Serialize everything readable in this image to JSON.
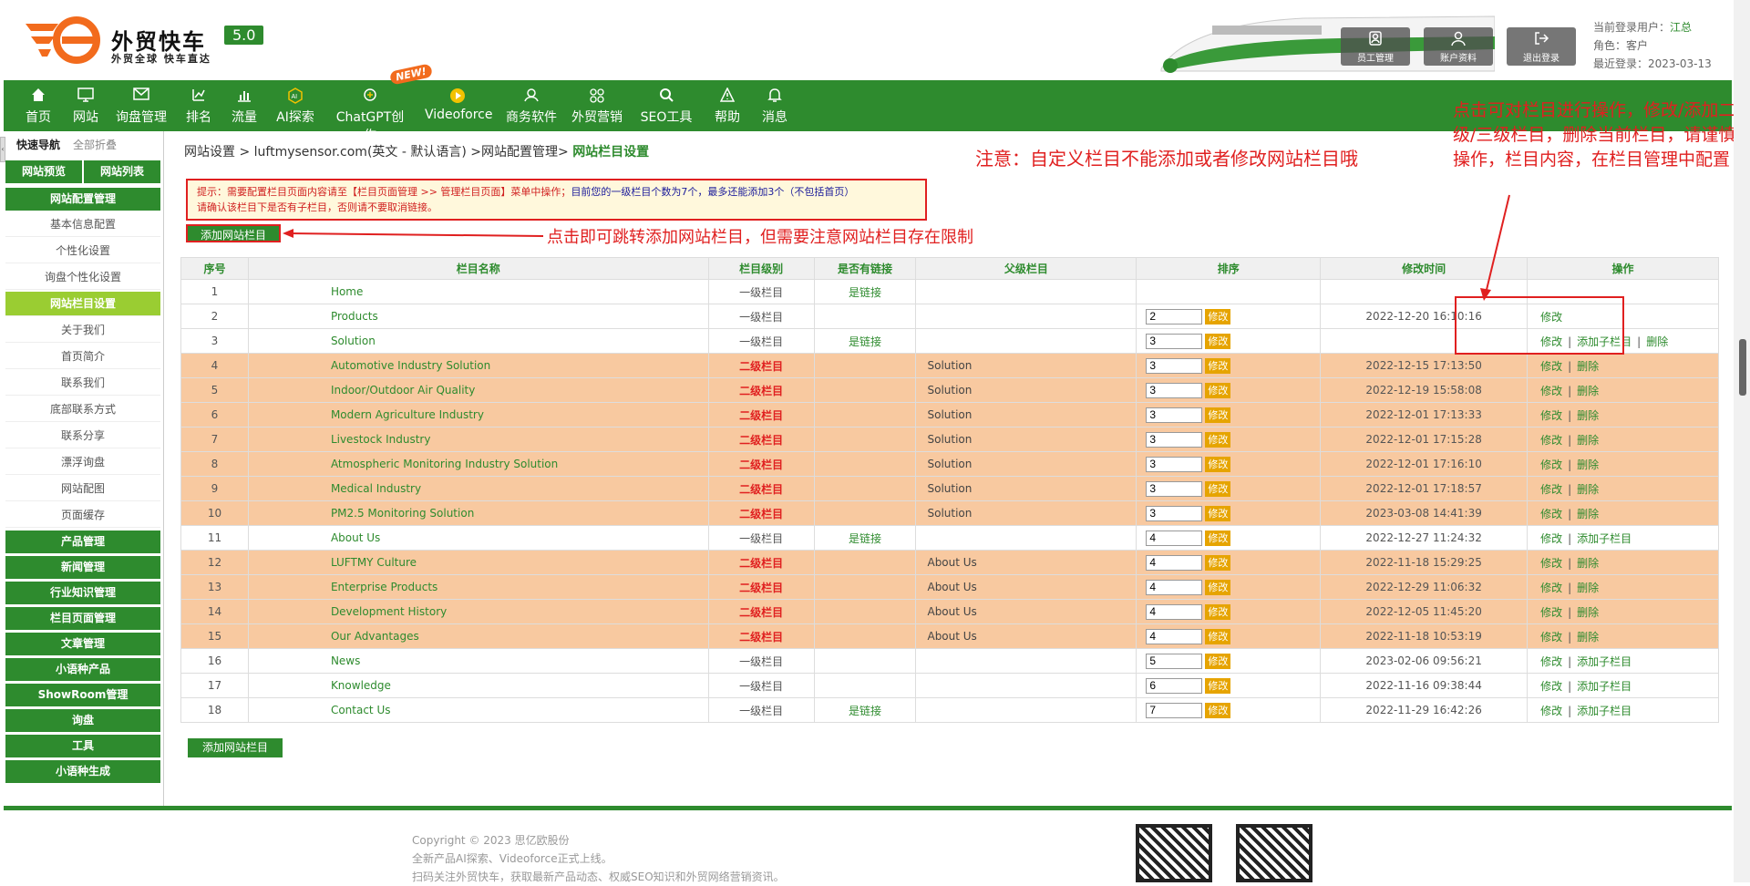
{
  "brand": {
    "name": "外贸快车",
    "version": "5.0",
    "slogan": "外贸全球 快车直达"
  },
  "header_buttons": [
    {
      "label": "员工管理",
      "icon": "staff-icon"
    },
    {
      "label": "账户资料",
      "icon": "user-icon"
    },
    {
      "label": "退出登录",
      "icon": "logout-icon"
    }
  ],
  "user": {
    "login_label": "当前登录用户：",
    "login_name": "江总",
    "role_label": "角色：",
    "role": "客户",
    "last_label": "最近登录：",
    "last": "2023-03-13"
  },
  "nav": [
    {
      "label": "首页",
      "icon": "home-icon"
    },
    {
      "label": "网站",
      "icon": "monitor-icon"
    },
    {
      "label": "询盘管理",
      "icon": "mail-icon"
    },
    {
      "label": "排名",
      "icon": "rank-icon"
    },
    {
      "label": "流量",
      "icon": "chart-icon"
    },
    {
      "label": "AI探索",
      "icon": "ai-icon"
    },
    {
      "label": "ChatGPT创作",
      "icon": "chatgpt-icon"
    },
    {
      "label": "Videoforce",
      "icon": "video-icon"
    },
    {
      "label": "商务软件",
      "icon": "software-icon"
    },
    {
      "label": "外贸营销",
      "icon": "marketing-icon"
    },
    {
      "label": "SEO工具",
      "icon": "search-icon"
    },
    {
      "label": "帮助",
      "icon": "help-icon"
    },
    {
      "label": "消息",
      "icon": "bell-icon"
    }
  ],
  "new_badge": "NEW!",
  "sidebar": {
    "quick_nav": "快速导航",
    "collapse_all": "全部折叠",
    "preview": "网站预览",
    "site_list": "网站列表",
    "config_group": "网站配置管理",
    "config_items": [
      "基本信息配置",
      "个性化设置",
      "询盘个性化设置",
      "网站栏目设置",
      "关于我们",
      "首页简介",
      "联系我们",
      "底部联系方式",
      "联系分享",
      "漂浮询盘",
      "网站配图",
      "页面缓存"
    ],
    "groups": [
      "产品管理",
      "新闻管理",
      "行业知识管理",
      "栏目页面管理",
      "文章管理",
      "小语种产品",
      "ShowRoom管理",
      "询盘",
      "工具",
      "小语种生成"
    ]
  },
  "breadcrumb": {
    "path": "网站设置 > luftmysensor.com(英文 - 默认语言) >网站配置管理> ",
    "current": "网站栏目设置"
  },
  "notice": {
    "part1": "提示：需要配置栏目页面内容请至【栏目页面管理 >> 管理栏目页面】菜单中操作；",
    "part2": "目前您的一级栏目个数为7个，最多还能添加3个（不包括首页）",
    "part3": "请确认该栏目下是否有子栏目，否则请不要取消链接。"
  },
  "add_button": "添加网站栏目",
  "annotations": {
    "a1": "注意：自定义栏目不能添加或者修改网站栏目哦",
    "a2": "点击即可跳转添加网站栏目，但需要注意网站栏目存在限制",
    "a3": "点击可对栏目进行操作，修改/添加二级/三级栏目，删除当前栏目，请谨慎操作，栏目内容，在栏目管理中配置"
  },
  "table": {
    "headers": [
      "序号",
      "栏目名称",
      "栏目级别",
      "是否有链接",
      "父级栏目",
      "排序",
      "修改时间",
      "操作"
    ],
    "sort_btn": "修改",
    "op_edit": "修改",
    "op_add": "添加子栏目",
    "op_delete": "删除",
    "rows": [
      {
        "no": "1",
        "name": "Home",
        "level": "一级栏目",
        "link": "是链接",
        "parent": "",
        "sort": "",
        "time": "",
        "ops": []
      },
      {
        "no": "2",
        "name": "Products",
        "level": "一级栏目",
        "link": "",
        "parent": "",
        "sort": "2",
        "time": "2022-12-20 16:10:16",
        "ops": [
          "edit"
        ]
      },
      {
        "no": "3",
        "name": "Solution",
        "level": "一级栏目",
        "link": "是链接",
        "parent": "",
        "sort": "3",
        "time": "",
        "ops": [
          "edit",
          "add",
          "delete"
        ]
      },
      {
        "no": "4",
        "name": "Automotive Industry Solution",
        "level": "二级栏目",
        "link": "",
        "parent": "Solution",
        "sort": "3",
        "time": "2022-12-15 17:13:50",
        "ops": [
          "edit",
          "delete"
        ]
      },
      {
        "no": "5",
        "name": "Indoor/Outdoor Air Quality",
        "level": "二级栏目",
        "link": "",
        "parent": "Solution",
        "sort": "3",
        "time": "2022-12-19 15:58:08",
        "ops": [
          "edit",
          "delete"
        ]
      },
      {
        "no": "6",
        "name": "Modern Agriculture Industry",
        "level": "二级栏目",
        "link": "",
        "parent": "Solution",
        "sort": "3",
        "time": "2022-12-01 17:13:33",
        "ops": [
          "edit",
          "delete"
        ]
      },
      {
        "no": "7",
        "name": "Livestock Industry",
        "level": "二级栏目",
        "link": "",
        "parent": "Solution",
        "sort": "3",
        "time": "2022-12-01 17:15:28",
        "ops": [
          "edit",
          "delete"
        ]
      },
      {
        "no": "8",
        "name": "Atmospheric Monitoring Industry Solution",
        "level": "二级栏目",
        "link": "",
        "parent": "Solution",
        "sort": "3",
        "time": "2022-12-01 17:16:10",
        "ops": [
          "edit",
          "delete"
        ]
      },
      {
        "no": "9",
        "name": "Medical Industry",
        "level": "二级栏目",
        "link": "",
        "parent": "Solution",
        "sort": "3",
        "time": "2022-12-01 17:18:57",
        "ops": [
          "edit",
          "delete"
        ]
      },
      {
        "no": "10",
        "name": "PM2.5 Monitoring Solution",
        "level": "二级栏目",
        "link": "",
        "parent": "Solution",
        "sort": "3",
        "time": "2023-03-08 14:41:39",
        "ops": [
          "edit",
          "delete"
        ]
      },
      {
        "no": "11",
        "name": "About Us",
        "level": "一级栏目",
        "link": "是链接",
        "parent": "",
        "sort": "4",
        "time": "2022-12-27 11:24:32",
        "ops": [
          "edit",
          "add"
        ]
      },
      {
        "no": "12",
        "name": "LUFTMY Culture",
        "level": "二级栏目",
        "link": "",
        "parent": "About Us",
        "sort": "4",
        "time": "2022-11-18 15:29:25",
        "ops": [
          "edit",
          "delete"
        ]
      },
      {
        "no": "13",
        "name": "Enterprise Products",
        "level": "二级栏目",
        "link": "",
        "parent": "About Us",
        "sort": "4",
        "time": "2022-12-29 11:06:32",
        "ops": [
          "edit",
          "delete"
        ]
      },
      {
        "no": "14",
        "name": "Development History",
        "level": "二级栏目",
        "link": "",
        "parent": "About Us",
        "sort": "4",
        "time": "2022-12-05 11:45:20",
        "ops": [
          "edit",
          "delete"
        ]
      },
      {
        "no": "15",
        "name": "Our Advantages",
        "level": "二级栏目",
        "link": "",
        "parent": "About Us",
        "sort": "4",
        "time": "2022-11-18 10:53:19",
        "ops": [
          "edit",
          "delete"
        ]
      },
      {
        "no": "16",
        "name": "News",
        "level": "一级栏目",
        "link": "",
        "parent": "",
        "sort": "5",
        "time": "2023-02-06 09:56:21",
        "ops": [
          "edit",
          "add"
        ]
      },
      {
        "no": "17",
        "name": "Knowledge",
        "level": "一级栏目",
        "link": "",
        "parent": "",
        "sort": "6",
        "time": "2022-11-16 09:38:44",
        "ops": [
          "edit",
          "add"
        ]
      },
      {
        "no": "18",
        "name": "Contact Us",
        "level": "一级栏目",
        "link": "是链接",
        "parent": "",
        "sort": "7",
        "time": "2022-11-29 16:42:26",
        "ops": [
          "edit",
          "add"
        ]
      }
    ]
  },
  "footer": {
    "copyright": "Copyright © 2023 思亿欧股份",
    "line2": "全新产品AI探索、Videoforce正式上线。",
    "line3": "扫码关注外贸快车，获取最新产品动态、权威SEO知识和外贸网络营销资讯。"
  },
  "colors": {
    "brand_green": "#2e8b2e",
    "child_row": "#f8c9a0",
    "annotation_red": "#e02020",
    "sort_button": "#e6a400"
  }
}
